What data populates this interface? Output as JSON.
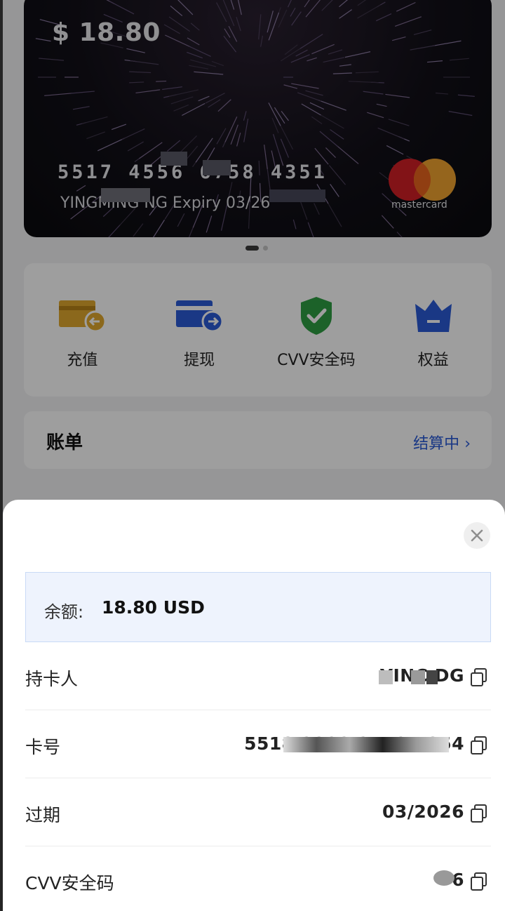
{
  "card": {
    "balance": "$ 18.80",
    "number": "5517 4556 6758 4351",
    "holder": "YINGMING  NG  Expiry 03/26",
    "brand": "mastercard"
  },
  "actions": [
    {
      "label": "充值",
      "icon": "top-up-card-icon",
      "color": "#e0a92e"
    },
    {
      "label": "提现",
      "icon": "withdraw-card-icon",
      "color": "#2a5bd7"
    },
    {
      "label": "CVV安全码",
      "icon": "shield-check-icon",
      "color": "#2e9e43"
    },
    {
      "label": "权益",
      "icon": "crown-icon",
      "color": "#2a5bd7"
    }
  ],
  "bill": {
    "title": "账单",
    "status": "结算中"
  },
  "sheet": {
    "balance_label": "余额:",
    "balance_value": "18.80 USD",
    "rows": [
      {
        "label": "持卡人",
        "value": "YINC                 DG"
      },
      {
        "label": "卡号",
        "value": "5518  2222  2512  7854"
      },
      {
        "label": "过期",
        "value": "03/2026"
      },
      {
        "label": "CVV安全码",
        "value": "   6"
      }
    ]
  }
}
